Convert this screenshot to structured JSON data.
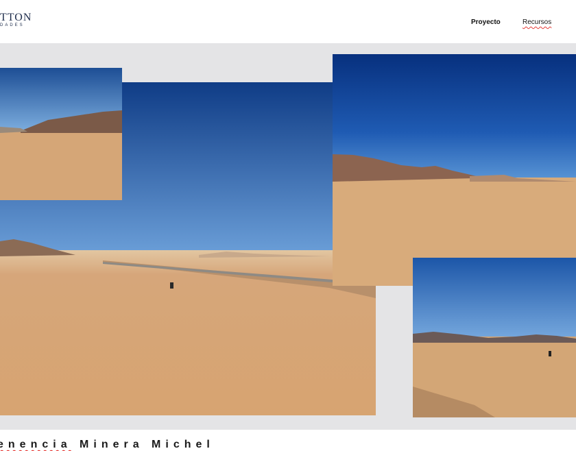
{
  "header": {
    "logo_text": "TTON",
    "logo_subtext": "DADES",
    "nav": [
      {
        "label": "Proyecto"
      },
      {
        "label": "Recursos"
      }
    ]
  },
  "gallery": {
    "caption_part1": "enencia",
    "caption_part2": " Minera Michel"
  },
  "colors": {
    "sky_top": "#0e3b86",
    "sky_bottom": "#5e97d6",
    "sand": "#d7a876",
    "mountain": "#8a6650",
    "background": "#e4e4e6"
  }
}
